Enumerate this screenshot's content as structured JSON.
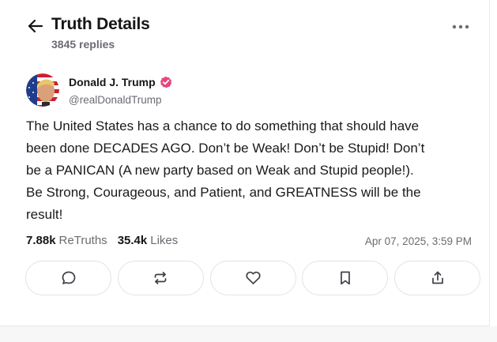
{
  "header": {
    "title": "Truth Details",
    "replies": "3845 replies"
  },
  "post": {
    "author": {
      "display_name": "Donald J. Trump",
      "handle": "@realDonaldTrump",
      "verified": true
    },
    "lines": [
      "The United States has a chance to do something that should have",
      "been done DECADES AGO. Don’t be Weak! Don’t be Stupid! Don’t",
      "be a PANICAN (A new party based on Weak and Stupid people!).",
      "Be Strong, Courageous, and Patient, and GREATNESS will be the",
      "result!"
    ],
    "stats": {
      "retruths_count": "7.88k",
      "retruths_label": "ReTruths",
      "likes_count": "35.4k",
      "likes_label": "Likes"
    },
    "timestamp": "Apr 07, 2025, 3:59 PM"
  },
  "colors": {
    "verified_badge": "#e8467c",
    "muted_text": "#6b6b73",
    "border": "#e3e3e8"
  },
  "icons": {
    "back": "arrow-left-icon",
    "more": "more-horizontal-icon",
    "reply": "chat-bubble-icon",
    "retruth": "repeat-icon",
    "like": "heart-icon",
    "bookmark": "bookmark-icon",
    "share": "share-icon"
  }
}
